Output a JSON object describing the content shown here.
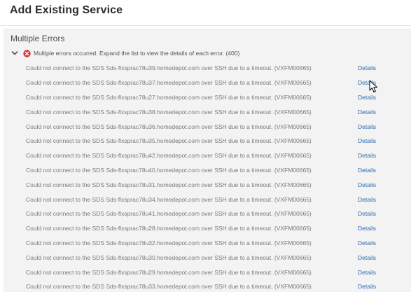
{
  "dialog": {
    "title": "Add Existing Service"
  },
  "panel": {
    "heading": "Multiple Errors",
    "summary": "Multiple errors occurred. Expand the list to view the details of each error. (400)",
    "details_label": "Details",
    "errors": [
      "Could not connect to the SDS Sds-flxsprac78u39.homedepot.com over SSH due to a timeout. (VXFM00665)",
      "Could not connect to the SDS Sds-flxsprac78u37.homedepot.com over SSH due to a timeout. (VXFM00665)",
      "Could not connect to the SDS Sds-flxsprac78u27.homedepot.com over SSH due to a timeout. (VXFM00665)",
      "Could not connect to the SDS Sds-flxsprac78u38.homedepot.com over SSH due to a timeout. (VXFM00665)",
      "Could not connect to the SDS Sds-flxsprac78u36.homedepot.com over SSH due to a timeout. (VXFM00665)",
      "Could not connect to the SDS Sds-flxsprac78u35.homedepot.com over SSH due to a timeout. (VXFM00665)",
      "Could not connect to the SDS Sds-flxsprac78u42.homedepot.com over SSH due to a timeout. (VXFM00665)",
      "Could not connect to the SDS Sds-flxsprac78u40.homedepot.com over SSH due to a timeout. (VXFM00665)",
      "Could not connect to the SDS Sds-flxsprac78u31.homedepot.com over SSH due to a timeout. (VXFM00665)",
      "Could not connect to the SDS Sds-flxsprac78u34.homedepot.com over SSH due to a timeout. (VXFM00665)",
      "Could not connect to the SDS Sds-flxsprac78u41.homedepot.com over SSH due to a timeout. (VXFM00665)",
      "Could not connect to the SDS Sds-flxsprac78u28.homedepot.com over SSH due to a timeout. (VXFM00665)",
      "Could not connect to the SDS Sds-flxsprac78u32.homedepot.com over SSH due to a timeout. (VXFM00665)",
      "Could not connect to the SDS Sds-flxsprac78u30.homedepot.com over SSH due to a timeout. (VXFM00665)",
      "Could not connect to the SDS Sds-flxsprac78u29.homedepot.com over SSH due to a timeout. (VXFM00665)",
      "Could not connect to the SDS Sds-flxsprac78u33.homedepot.com over SSH due to a timeout. (VXFM00665)"
    ]
  },
  "icons": {
    "expand": "chevron-down-icon",
    "error": "error-circle-icon",
    "cursor": "mouse-pointer-icon"
  },
  "colors": {
    "error_icon": "#d9383a",
    "link": "#2f6bb0",
    "panel_bg": "#f3f3f3"
  }
}
